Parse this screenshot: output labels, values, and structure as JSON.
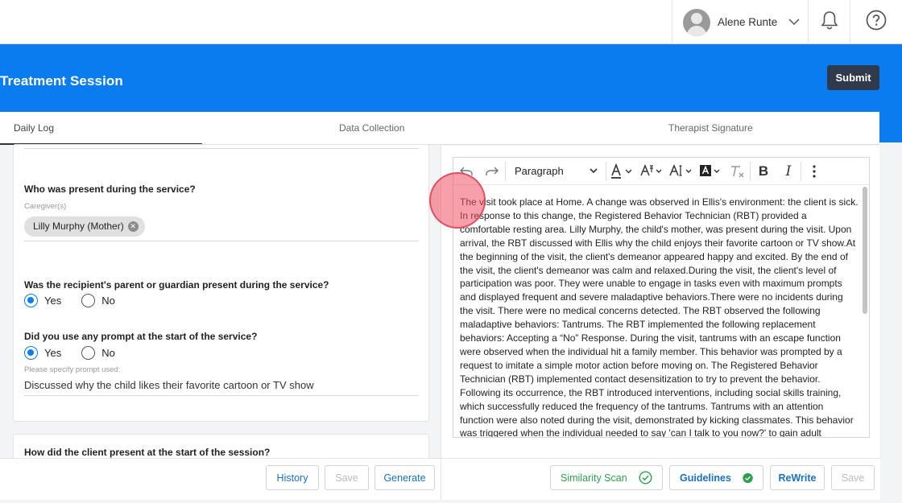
{
  "topbar": {
    "user_name": "Alene Runte",
    "icons": [
      "avatar",
      "chevron-down-icon",
      "bell-icon",
      "help-icon"
    ]
  },
  "banner": {
    "title": "Treatment Session",
    "submit_label": "Submit"
  },
  "tabs": [
    {
      "label": "Daily Log",
      "active": true
    },
    {
      "label": "Data Collection",
      "active": false
    },
    {
      "label": "Therapist Signature",
      "active": false
    }
  ],
  "form": {
    "q_present": "Who was present during the service?",
    "caregiver_label": "Caregiver(s)",
    "caregiver_chip": "Lilly Murphy (Mother)",
    "q_parent": "Was the recipient's parent or guardian present during the service?",
    "q_prompt": "Did you use any prompt at the start of the service?",
    "yes_label": "Yes",
    "no_label": "No",
    "parent_answer": "Yes",
    "prompt_answer": "Yes",
    "prompt_specify_label": "Please specify prompt used:",
    "prompt_specify_value": "Discussed why the child likes their favorite cartoon or TV show",
    "q_client_present": "How did the client present at the start of the session?"
  },
  "left_footer": {
    "history_label": "History",
    "save_label": "Save",
    "generate_label": "Generate"
  },
  "editor": {
    "block_format": "Paragraph",
    "body_text": "The visit took place at Home. A change was observed in Ellis's environment: the client is sick. In response to this change, the Registered Behavior Technician (RBT) provided a comfortable resting area. Lilly Murphy, the child's mother, was present during the visit. Upon arrival, the RBT discussed with Ellis why the child enjoys their favorite cartoon or TV show.At the beginning of the visit, the client's demeanor appeared happy and excited. By the end of the visit, the client's demeanor was calm and relaxed.During the visit, the client's level of participation was poor. They were unable to engage in tasks even with maximum prompts and displayed frequent and severe maladaptive behaviors.There were no incidents during the visit. There were no medical concerns detected. The RBT observed the following maladaptive behaviors: Tantrums. The RBT implemented the following replacement behaviors: Accepting a “No” Response. During the visit, tantrums with an escape function were observed when the individual hit a family member. This behavior was prompted by a request to imitate a simple motor action before moving on. The Registered Behavior Technician (RBT) implemented contact desensitization to try to prevent the behavior. Following its occurrence, the RBT introduced interventions, including social skills training, which successfully reduced the frequency of the tantrums. Tantrums with an attention function were also noted during the visit, demonstrated by kicking classmates. This behavior was triggered when the individual needed to say 'can I talk to you now?' to gain adult attention. The RBT employed social skills"
  },
  "right_footer": {
    "similarity_label": "Similarity Scan",
    "guidelines_label": "Guidelines",
    "rewrite_label": "ReWrite",
    "save_label": "Save"
  },
  "colors": {
    "brand_blue": "#0a7cf0",
    "submit_bg": "#2f3a4c",
    "success_green": "#2e9f4d",
    "touch_indicator": "#f05064"
  }
}
